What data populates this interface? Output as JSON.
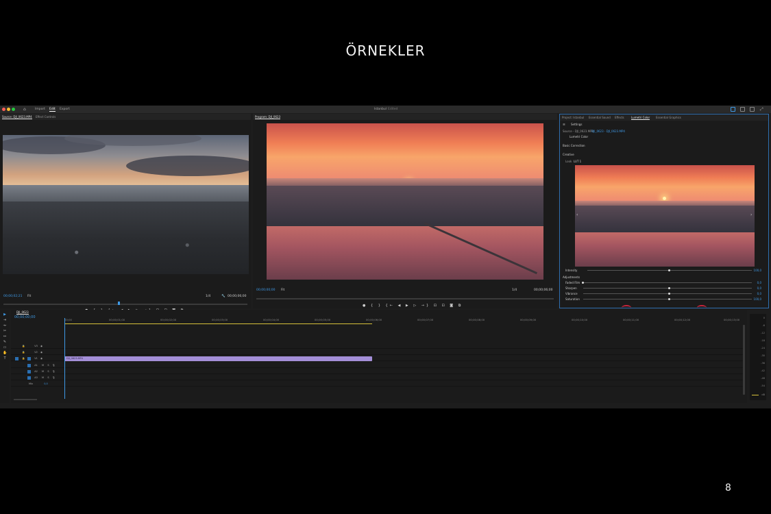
{
  "slide": {
    "title": "ÖRNEKLER",
    "page_number": "8"
  },
  "app": {
    "workspace_tabs": [
      "Import",
      "Edit",
      "Export"
    ],
    "active_workspace": "Edit",
    "project_title": "Istanbul",
    "project_status": "Edited"
  },
  "source_panel": {
    "tabs": [
      "Source: DJI_0623.MP4",
      "Effect Controls"
    ],
    "timecode_current": "00;00;02;21",
    "fit_label": "Fit",
    "zoom_label": "1/4",
    "timecode_duration": "00;00;06;00"
  },
  "program_panel": {
    "tab": "Program: DJI_0623",
    "timecode_current": "00;00;00;00",
    "fit_label": "Fit",
    "zoom_label": "1/4",
    "timecode_duration": "00;00;06;00"
  },
  "lumetri": {
    "tabs": [
      "Project: Istanbul",
      "Essential Sound",
      "Effects",
      "Lumetri Color",
      "Essential Graphics"
    ],
    "active_tab": "Lumetri Color",
    "settings_label": "Settings",
    "source_path": "Source - DJI_0623.MP4",
    "source_clip": "DJI_0623 - DJI_0623.MP4",
    "effect_name": "Lumetri Color",
    "basic_correction": "Basic Correction",
    "creative": "Creative",
    "look_label": "Look",
    "look_value": "LUT 1",
    "intensity_label": "Intensity",
    "intensity_value": "100,0",
    "adjustments_label": "Adjustments",
    "adjustments": [
      {
        "label": "Faded Film",
        "value": "0,0"
      },
      {
        "label": "Sharpen",
        "value": "0,0"
      },
      {
        "label": "Vibrance",
        "value": "0,0"
      },
      {
        "label": "Saturation",
        "value": "100,0"
      }
    ]
  },
  "timeline": {
    "sequence_tab": "DJI_0623",
    "timecode": "00;00;00;00",
    "ruler_ticks": [
      "00;00",
      "00;00;01;00",
      "00;00;02;00",
      "00;00;03;00",
      "00;00;04;00",
      "00;00;05;00",
      "00;00;06;00",
      "00;00;07;00",
      "00;00;08;00",
      "00;00;09;00",
      "00;00;10;00",
      "00;00;11;00",
      "00;00;12;00",
      "00;00;13;00"
    ],
    "clip_name": "DJI_0623.MP4",
    "mix_label": "Mix",
    "mix_value": "0,0",
    "video_tracks": [
      "V3",
      "V2",
      "V1"
    ],
    "audio_tracks": [
      "A1",
      "A2",
      "A3"
    ]
  },
  "meter": {
    "labels": [
      "0",
      "-6",
      "-12",
      "-18",
      "-24",
      "-30",
      "-36",
      "-42",
      "-48",
      "-54",
      "dB"
    ]
  },
  "colors": {
    "accent": "#3f9be8",
    "clip": "#a48fd8",
    "work_area": "#d8c23a"
  }
}
